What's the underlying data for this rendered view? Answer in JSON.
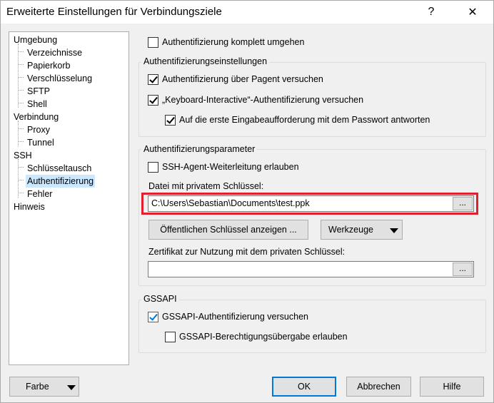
{
  "window": {
    "title": "Erweiterte Einstellungen für Verbindungsziele",
    "help_symbol": "?",
    "close_symbol": "✕"
  },
  "tree": {
    "items": [
      {
        "label": "Umgebung"
      },
      {
        "label": "Verzeichnisse"
      },
      {
        "label": "Papierkorb"
      },
      {
        "label": "Verschlüsselung"
      },
      {
        "label": "SFTP"
      },
      {
        "label": "Shell"
      },
      {
        "label": "Verbindung"
      },
      {
        "label": "Proxy"
      },
      {
        "label": "Tunnel"
      },
      {
        "label": "SSH"
      },
      {
        "label": "Schlüsseltausch"
      },
      {
        "label": "Authentifizierung",
        "selected": true
      },
      {
        "label": "Fehler"
      },
      {
        "label": "Hinweis"
      }
    ]
  },
  "auth_bypass": {
    "label": "Authentifizierung komplett umgehen",
    "checked": false
  },
  "auth_settings": {
    "title": "Authentifizierungseinstellungen",
    "pageant": {
      "label": "Authentifizierung über Pagent versuchen",
      "checked": true
    },
    "keyboard_interactive": {
      "label": "„Keyboard-Interactive“-Authentifizierung versuchen",
      "checked": true
    },
    "first_prompt": {
      "label": "Auf die erste Eingabeaufforderung mit dem Passwort antworten",
      "checked": true
    }
  },
  "auth_params": {
    "title": "Authentifizierungsparameter",
    "agent_forwarding": {
      "label": "SSH-Agent-Weiterleitung erlauben",
      "checked": false
    },
    "private_key_label": "Datei mit privatem Schlüssel:",
    "private_key_value": "C:\\Users\\Sebastian\\Documents\\test.ppk",
    "browse_label": "...",
    "show_public_key_label": "Öffentlichen Schlüssel anzeigen ...",
    "tools_label": "Werkzeuge",
    "certificate_label": "Zertifikat zur Nutzung mit dem privaten Schlüssel:",
    "certificate_value": "",
    "cert_browse_label": "..."
  },
  "gssapi": {
    "title": "GSSAPI",
    "auth": {
      "label": "GSSAPI-Authentifizierung versuchen",
      "checked": true
    },
    "delegation": {
      "label": "GSSAPI-Berechtigungsübergabe erlauben",
      "checked": false
    }
  },
  "footer": {
    "color_label": "Farbe",
    "ok_label": "OK",
    "cancel_label": "Abbrechen",
    "help_label": "Hilfe"
  },
  "colors": {
    "highlight_border": "#e0202e",
    "selection": "#cce8ff",
    "accent": "#0078d7"
  }
}
